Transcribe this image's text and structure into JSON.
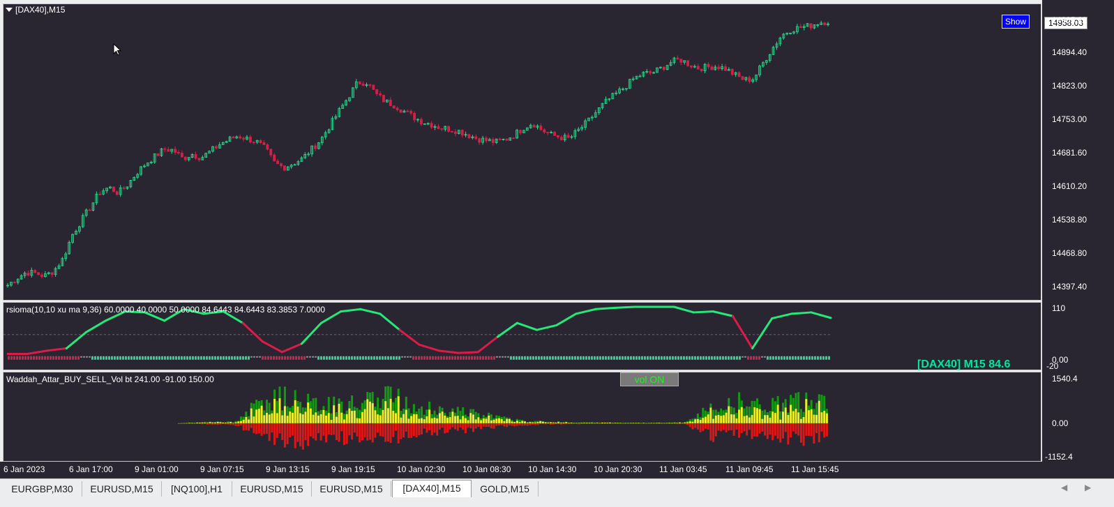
{
  "chart": {
    "title": "[DAX40],M15",
    "last_price": "14958.03",
    "show_button": "Show"
  },
  "price_axis": {
    "ticks": [
      "14965.20",
      "14894.40",
      "14823.00",
      "14753.00",
      "14681.60",
      "14610.20",
      "14538.80",
      "14468.80",
      "14397.40"
    ]
  },
  "rsi_panel": {
    "title": "rsioma(10,10 xu ma 9,36) 60.0000 40.0000 50.0000 84.6443 84.6443 83.3853 7.0000",
    "ticks": [
      "110",
      "0.00",
      "-20"
    ],
    "tag": "[DAX40] M15  84.6"
  },
  "vol_panel": {
    "title": "Waddah_Attar_BUY_SELL_Vol bt 241.00 -91.00 150.00",
    "button": "vol ON",
    "ticks": [
      "1540.4",
      "0.00",
      "-1152.4"
    ]
  },
  "time_axis": {
    "labels": [
      "6 Jan 2023",
      "6 Jan 17:00",
      "9 Jan 01:00",
      "9 Jan 07:15",
      "9 Jan 13:15",
      "9 Jan 19:15",
      "10 Jan 02:30",
      "10 Jan 08:30",
      "10 Jan 14:30",
      "10 Jan 20:30",
      "11 Jan 03:45",
      "11 Jan 09:45",
      "11 Jan 15:45"
    ]
  },
  "tabs": [
    "EURGBP,M30",
    "EURUSD,M15",
    "[NQ100],H1",
    "EURUSD,M15",
    "EURUSD,M15",
    "[DAX40],M15",
    "GOLD,M15"
  ],
  "active_tab": "[DAX40],M15",
  "icons": {
    "menu": "dropdown-triangle-icon",
    "cursor": "mouse-pointer-icon",
    "scroll_left": "arrow-left-icon",
    "scroll_right": "arrow-right-icon"
  },
  "colors": {
    "background": "#2a2631",
    "bull": "#26d98a",
    "bear": "#d42046",
    "rsi_up": "#26e87a",
    "rsi_down": "#d91c48",
    "vol_up": "#139a13",
    "vol_mid": "#eded2a",
    "vol_down": "#e01616"
  },
  "chart_data": [
    {
      "type": "candlestick",
      "title": "[DAX40],M15",
      "ylim": [
        14380,
        14985
      ],
      "close_series": [
        14405,
        14420,
        14432,
        14430,
        14424,
        14435,
        14460,
        14510,
        14540,
        14570,
        14600,
        14610,
        14598,
        14615,
        14640,
        14660,
        14675,
        14690,
        14688,
        14670,
        14680,
        14672,
        14685,
        14700,
        14710,
        14718,
        14712,
        14706,
        14690,
        14660,
        14652,
        14660,
        14670,
        14690,
        14710,
        14740,
        14770,
        14800,
        14830,
        14830,
        14805,
        14790,
        14782,
        14770,
        14758,
        14748,
        14742,
        14735,
        14732,
        14728,
        14720,
        14712,
        14708,
        14705,
        14710,
        14720,
        14735,
        14745,
        14730,
        14720,
        14715,
        14712,
        14730,
        14748,
        14770,
        14790,
        14805,
        14820,
        14838,
        14848,
        14850,
        14860,
        14872,
        14878,
        14868,
        14860,
        14862,
        14864,
        14858,
        14845,
        14835,
        14838,
        14870,
        14900,
        14928,
        14940,
        14945,
        14948,
        14955,
        14958
      ]
    },
    {
      "type": "line",
      "title": "rsioma(10,10 xu ma 9,36) 60.0000 40.0000 50.0000 84.6443 84.6443 83.3853 7.0000",
      "ylim": [
        -20,
        110
      ],
      "x": [
        "6 Jan 2023",
        "6 Jan 17:00",
        "9 Jan 01:00",
        "9 Jan 07:15",
        "9 Jan 13:15",
        "9 Jan 19:15",
        "10 Jan 02:30",
        "10 Jan 08:30",
        "10 Jan 14:30",
        "10 Jan 20:30",
        "11 Jan 03:45",
        "11 Jan 09:45",
        "11 Jan 15:45"
      ],
      "values": [
        8,
        8,
        15,
        20,
        55,
        80,
        100,
        98,
        80,
        105,
        95,
        100,
        75,
        35,
        12,
        30,
        75,
        100,
        105,
        95,
        60,
        28,
        15,
        10,
        12,
        45,
        75,
        60,
        70,
        95,
        105,
        108,
        110,
        110,
        110,
        98,
        100,
        90,
        20,
        85,
        95,
        98,
        86
      ]
    },
    {
      "type": "bar",
      "title": "Waddah_Attar_BUY_SELL_Vol bt 241.00 -91.00 150.00",
      "ylim": [
        -1152.4,
        1540.4
      ],
      "series": [
        {
          "values": [
            0,
            0,
            0,
            0,
            0,
            0,
            0,
            50,
            60,
            900,
            1100,
            800,
            700,
            1200,
            900,
            600,
            500,
            300,
            120,
            80,
            40,
            30,
            20,
            20,
            40,
            700,
            900,
            700,
            900,
            800
          ]
        },
        {
          "values": [
            0,
            0,
            0,
            0,
            0,
            0,
            0,
            -40,
            -60,
            -500,
            -900,
            -700,
            -600,
            -800,
            -500,
            -400,
            -300,
            -200,
            -80,
            -50,
            -30,
            -20,
            -20,
            -20,
            -30,
            -600,
            -400,
            -500,
            -700,
            -600
          ]
        }
      ]
    }
  ]
}
